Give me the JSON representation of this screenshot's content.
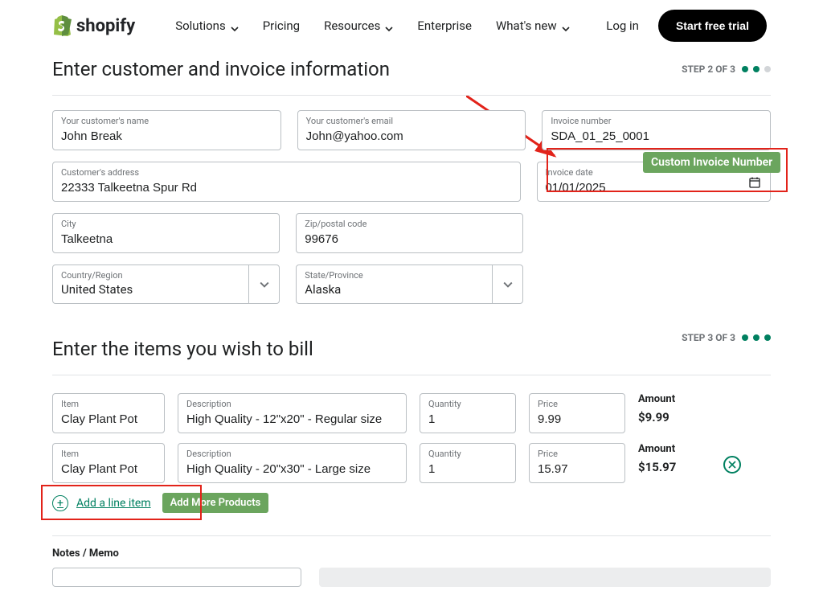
{
  "brand": "shopify",
  "nav": {
    "solutions": "Solutions",
    "pricing": "Pricing",
    "resources": "Resources",
    "enterprise": "Enterprise",
    "whatsnew": "What's new"
  },
  "auth": {
    "login": "Log in",
    "start_trial": "Start free trial"
  },
  "section_customer": {
    "title": "Enter customer and invoice information",
    "step_label": "STEP 2 OF 3"
  },
  "customer": {
    "name_label": "Your customer's name",
    "name_value": "John Break",
    "email_label": "Your customer's email",
    "email_value": "John@yahoo.com",
    "address_label": "Customer's address",
    "address_value": "22333 Talkeetna Spur Rd",
    "city_label": "City",
    "city_value": "Talkeetna",
    "zip_label": "Zip/postal code",
    "zip_value": "99676",
    "country_label": "Country/Region",
    "country_value": "United States",
    "state_label": "State/Province",
    "state_value": "Alaska"
  },
  "invoice": {
    "number_label": "Invoice number",
    "number_value": "SDA_01_25_0001",
    "date_label": "Invoice date",
    "date_value": "01/01/2025"
  },
  "callouts": {
    "custom_invoice": "Custom Invoice Number",
    "add_more": "Add More Products"
  },
  "section_items": {
    "title": "Enter the items you wish to bill",
    "step_label": "STEP 3 OF 3"
  },
  "item_labels": {
    "item": "Item",
    "desc": "Description",
    "qty": "Quantity",
    "price": "Price",
    "amount": "Amount"
  },
  "items": [
    {
      "item": "Clay Plant Pot",
      "desc": "High Quality - 12\"x20\" - Regular size",
      "qty": "1",
      "price": "9.99",
      "amount": "$9.99"
    },
    {
      "item": "Clay Plant Pot",
      "desc": "High Quality - 20\"x30\" - Large size",
      "qty": "1",
      "price": "15.97",
      "amount": "$15.97"
    }
  ],
  "add_line_label": "Add a line item",
  "notes_label": "Notes / Memo"
}
